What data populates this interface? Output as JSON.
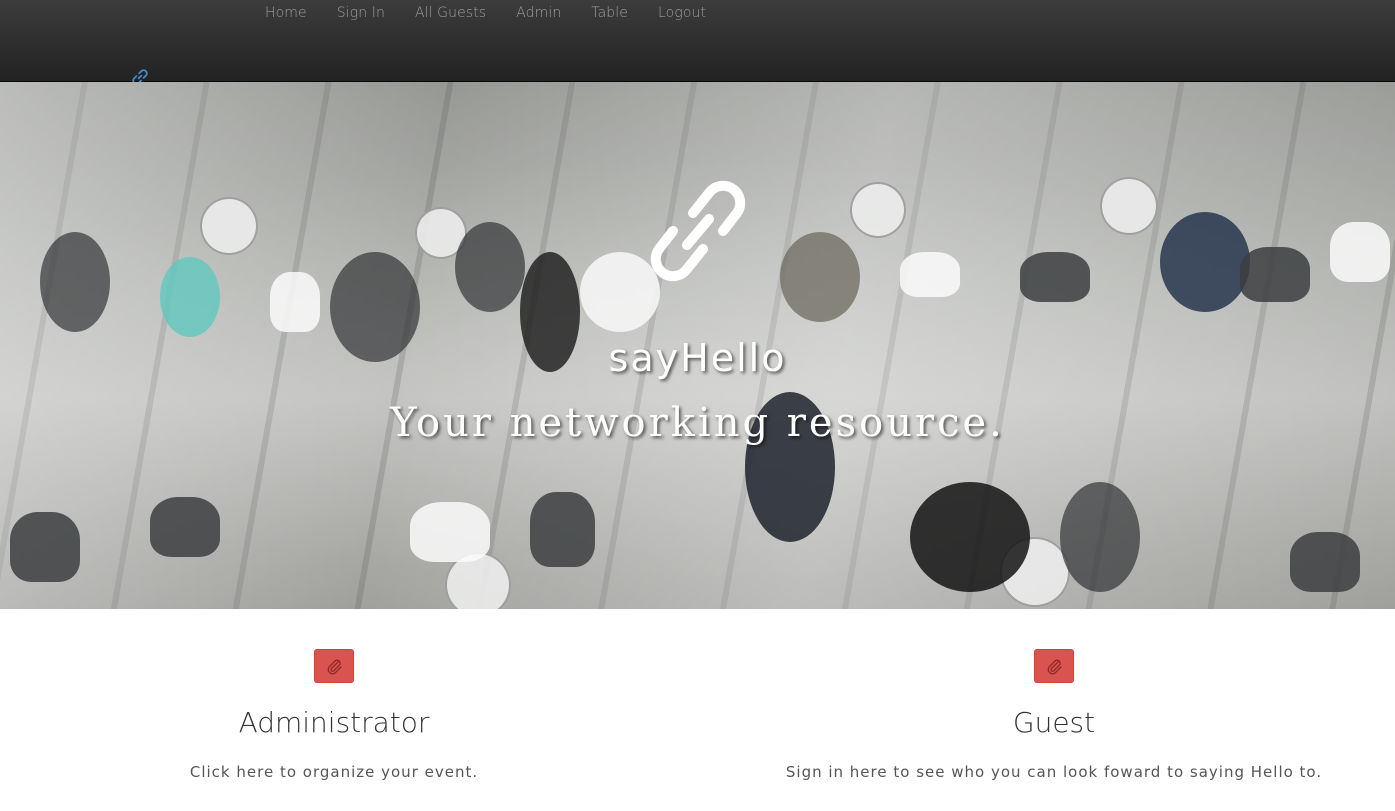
{
  "nav": {
    "items": [
      {
        "label": "Home"
      },
      {
        "label": "Sign In"
      },
      {
        "label": "All Guests"
      },
      {
        "label": "Admin"
      },
      {
        "label": "Table"
      },
      {
        "label": "Logout"
      }
    ],
    "brand_icon": "link-icon"
  },
  "hero": {
    "logo_icon": "link-icon",
    "title": "sayHello",
    "subtitle": "Your networking resource."
  },
  "features": [
    {
      "icon": "paperclip-icon",
      "title": "Administrator",
      "text": "Click here to organize your event."
    },
    {
      "icon": "paperclip-icon",
      "title": "Guest",
      "text": "Sign in here to see who you can look foward to saying Hello to."
    }
  ],
  "colors": {
    "navbar": "#222222",
    "nav_link": "#9d9d9d",
    "brand_icon": "#428bca",
    "feature_button": "#d9534f"
  }
}
